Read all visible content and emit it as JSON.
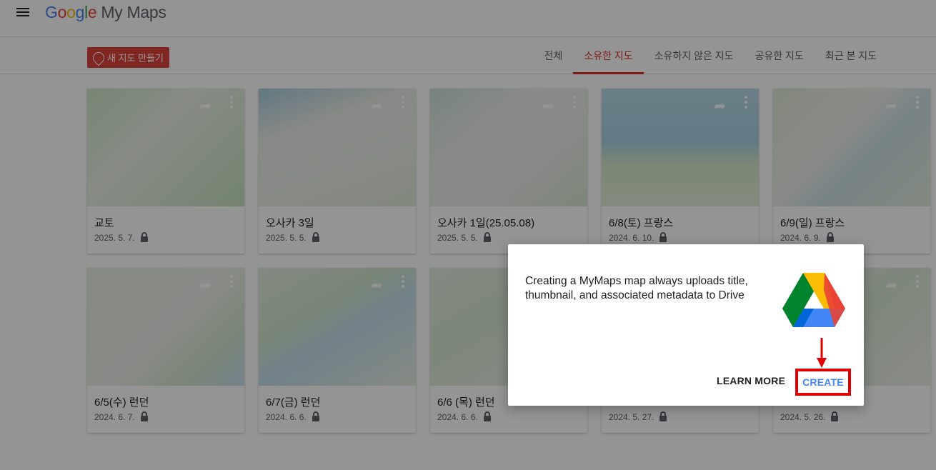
{
  "app": {
    "logo_google": [
      "G",
      "o",
      "o",
      "g",
      "l",
      "e"
    ],
    "logo_product": "My Maps"
  },
  "toolbar": {
    "new_map_label": "새 지도 만들기"
  },
  "tabs": [
    {
      "label": "전체"
    },
    {
      "label": "소유한 지도",
      "active": true
    },
    {
      "label": "소유하지 않은 지도"
    },
    {
      "label": "공유한 지도"
    },
    {
      "label": "최근 본 지도"
    }
  ],
  "maps": [
    {
      "title": "교토",
      "date": "2025. 5. 7."
    },
    {
      "title": "오사카 3일",
      "date": "2025. 5. 5."
    },
    {
      "title": "오사카 1일(25.05.08)",
      "date": "2025. 5. 5."
    },
    {
      "title": "6/8(토) 프랑스",
      "date": "2024. 6. 10."
    },
    {
      "title": "6/9(일) 프랑스",
      "date": "2024. 6. 9."
    },
    {
      "title": "6/5(수) 런던",
      "date": "2024. 6. 7."
    },
    {
      "title": "6/7(금) 런던",
      "date": "2024. 6. 6."
    },
    {
      "title": "6/6 (목) 런던",
      "date": "2024. 6. 6."
    },
    {
      "title": "",
      "date": "2024. 5. 27."
    },
    {
      "title": "",
      "date": "2024. 5. 26."
    }
  ],
  "dialog": {
    "message": "Creating a MyMaps map always uploads title, thumbnail, and associated metadata to Drive",
    "learn_more": "LEARN MORE",
    "create": "CREATE"
  },
  "colors": {
    "accent": "#d93025",
    "create_button": "#4285f4",
    "highlight_box": "#e00000"
  }
}
